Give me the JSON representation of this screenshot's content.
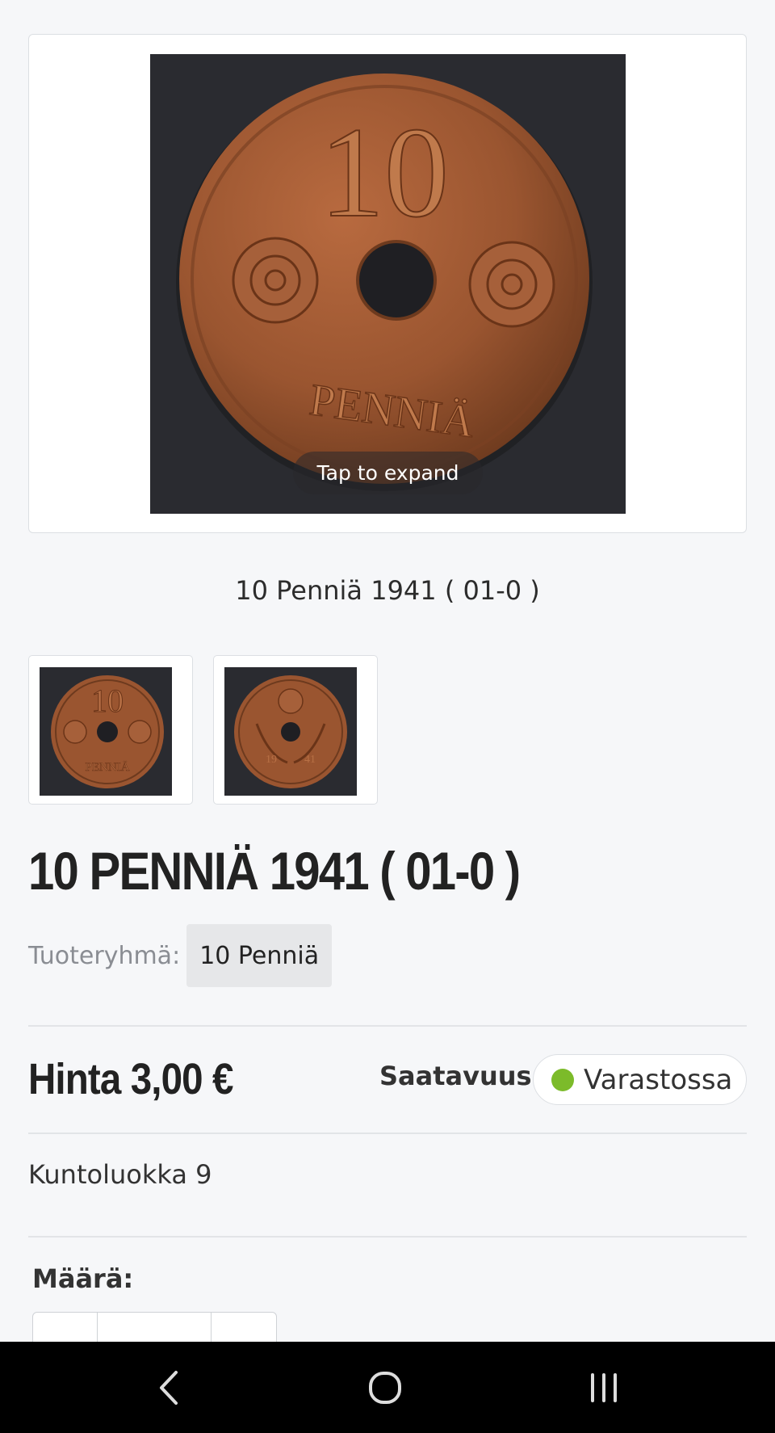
{
  "gallery": {
    "expand_label": "Tap to expand",
    "caption": "10 Penniä 1941 ( 01-0 )",
    "main_coin": {
      "denomination": "10",
      "inscription": "PENNIÄ"
    },
    "reverse_coin": {
      "year_left": "19",
      "year_right": "41"
    }
  },
  "product": {
    "title": "10 PENNIÄ 1941 ( 01-0 )",
    "group_label": "Tuoteryhmä:",
    "group_value": "10 Penniä",
    "price": "Hinta 3,00 €",
    "availability_label": "Saatavuus",
    "availability_value": "Varastossa",
    "condition": "Kuntoluokka 9",
    "quantity_label": "Määrä:"
  },
  "colors": {
    "background": "#f6f7f9",
    "in_stock": "#7cbb2a",
    "coin_copper": "#9a5530"
  },
  "system_nav": {
    "icons": [
      "back-icon",
      "home-icon",
      "recents-icon"
    ]
  }
}
